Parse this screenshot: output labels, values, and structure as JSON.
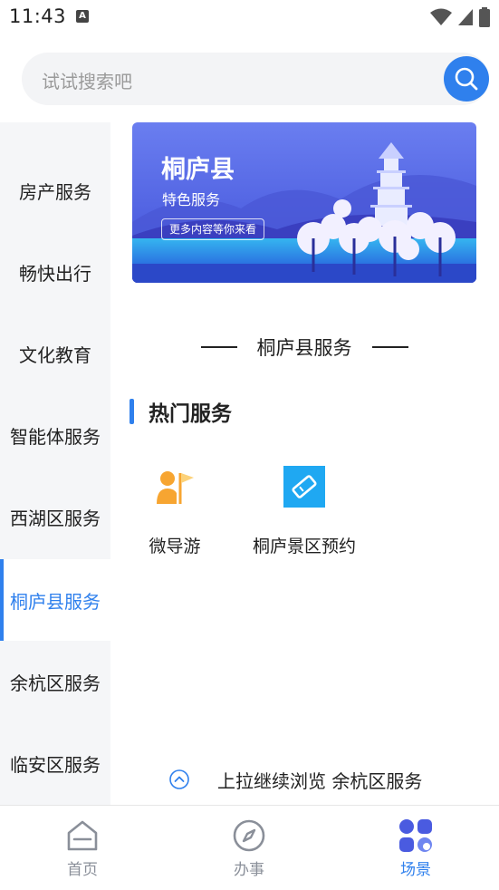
{
  "status_bar": {
    "time": "11:43",
    "app_icon_letter": "A"
  },
  "search": {
    "placeholder": "试试搜索吧"
  },
  "sidebar": {
    "items": [
      {
        "label": "房产服务",
        "active": false
      },
      {
        "label": "畅快出行",
        "active": false
      },
      {
        "label": "文化教育",
        "active": false
      },
      {
        "label": "智能体服务",
        "active": false
      },
      {
        "label": "西湖区服务",
        "active": false
      },
      {
        "label": "桐庐县服务",
        "active": true
      },
      {
        "label": "余杭区服务",
        "active": false
      },
      {
        "label": "临安区服务",
        "active": false
      }
    ]
  },
  "banner": {
    "title": "桐庐县",
    "subtitle": "特色服务",
    "more": "更多内容等你来看"
  },
  "section": {
    "title": "桐庐县服务"
  },
  "hot": {
    "title": "热门服务"
  },
  "services": [
    {
      "label": "微导游",
      "icon": "guide-person-flag-icon"
    },
    {
      "label": "桐庐景区预约",
      "icon": "ticket-icon"
    }
  ],
  "hint": {
    "text": "上拉继续浏览  余杭区服务"
  },
  "tabbar": {
    "items": [
      {
        "label": "首页",
        "icon": "home-icon",
        "active": false
      },
      {
        "label": "办事",
        "icon": "compass-icon",
        "active": false
      },
      {
        "label": "场景",
        "icon": "scene-grid-icon",
        "active": true
      }
    ]
  },
  "colors": {
    "accent": "#2f80ed",
    "sidebar_bg": "#f5f6f8",
    "guide_icon": "#f7a531",
    "ticket_icon": "#1fa8f2"
  }
}
